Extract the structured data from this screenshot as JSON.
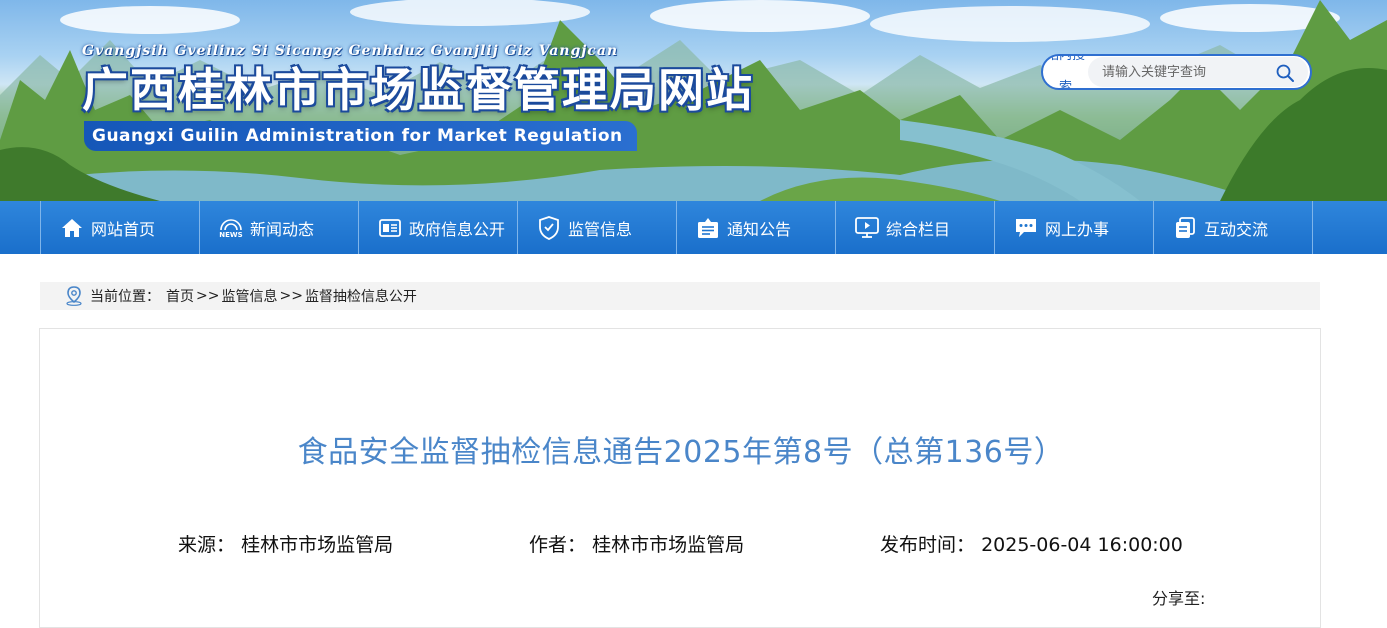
{
  "header": {
    "pinyin": "Gvangjsih Gveilinz Si Sicangz Genhduz Gvanjlij Giz Vangjcan",
    "title": "广西桂林市市场监督管理局网站",
    "english": "Guangxi Guilin Administration for Market Regulation"
  },
  "search": {
    "label": "站内搜索",
    "placeholder": "请输入关键字查询",
    "icon": "search-icon"
  },
  "nav": {
    "items": [
      {
        "label": "网站首页",
        "icon": "home-icon"
      },
      {
        "label": "新闻动态",
        "icon": "news-icon"
      },
      {
        "label": "政府信息公开",
        "icon": "document-icon"
      },
      {
        "label": "监管信息",
        "icon": "shield-icon"
      },
      {
        "label": "通知公告",
        "icon": "notice-icon"
      },
      {
        "label": "综合栏目",
        "icon": "monitor-icon"
      },
      {
        "label": "网上办事",
        "icon": "chat-icon"
      },
      {
        "label": "互动交流",
        "icon": "copy-icon"
      }
    ]
  },
  "breadcrumb": {
    "prefix": "当前位置：",
    "items": [
      "首页",
      "监管信息",
      "监督抽检信息公开"
    ],
    "separator": ">>"
  },
  "article": {
    "title": "食品安全监督抽检信息通告2025年第8号（总第136号）",
    "source_label": "来源：",
    "source": "桂林市市场监管局",
    "author_label": "作者：",
    "author": "桂林市市场监管局",
    "date_label": "发布时间：",
    "date": "2025-06-04 16:00:00",
    "share_label": "分享至:"
  },
  "colors": {
    "nav_blue": "#1f76d0",
    "title_blue": "#4a86c9",
    "banner_text_outline": "#1b4a9c"
  }
}
